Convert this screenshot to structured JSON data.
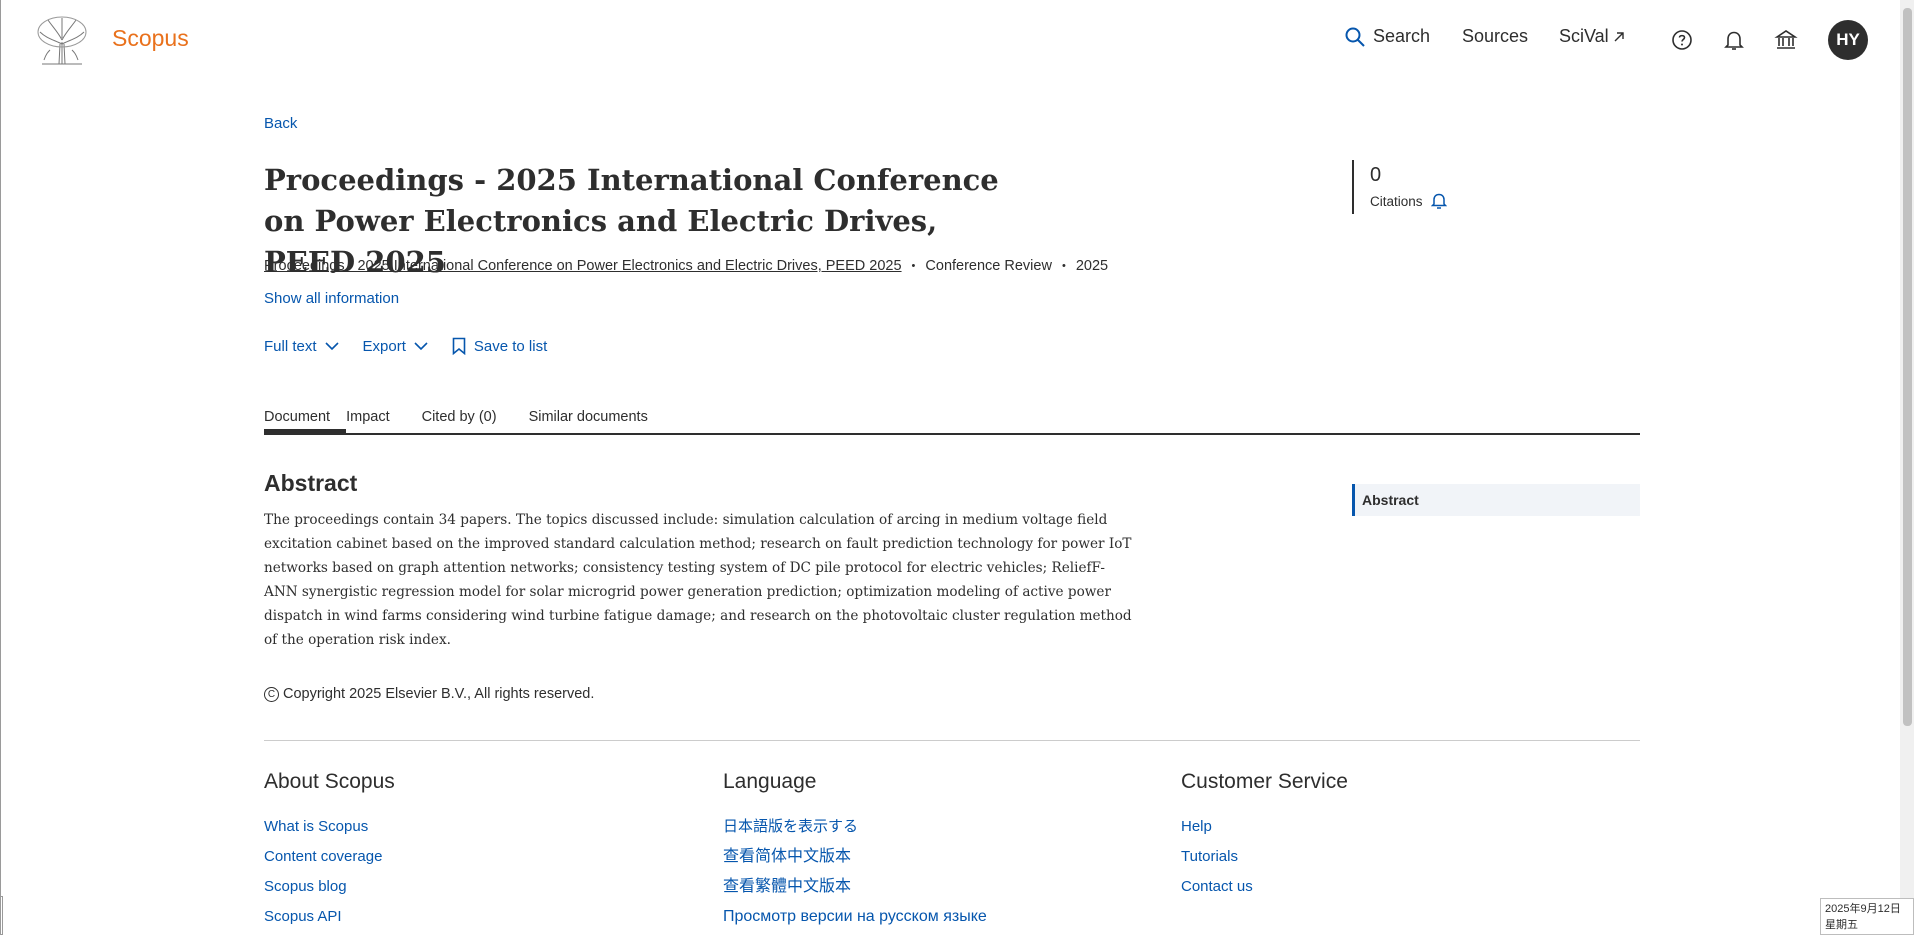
{
  "header": {
    "brand": "Scopus",
    "nav": {
      "search": "Search",
      "sources": "Sources",
      "scival": "SciVal"
    },
    "avatar_initials": "HY",
    "icons": [
      "help-icon",
      "bell-icon",
      "institution-icon"
    ]
  },
  "page": {
    "back": "Back",
    "title": "Proceedings - 2025 International Conference on Power Electronics and Electric Drives, PEED 2025",
    "source_link": "Proceedings - 2025 International Conference on Power Electronics and Electric Drives, PEED 2025",
    "doc_type": "Conference Review",
    "year": "2025",
    "show_all": "Show all information"
  },
  "actions": {
    "full_text": "Full text",
    "export": "Export",
    "save_to_list": "Save to list"
  },
  "citations": {
    "count": "0",
    "label": "Citations"
  },
  "tabs": [
    "Document",
    "Impact",
    "Cited by (0)",
    "Similar documents"
  ],
  "abstract": {
    "heading": "Abstract",
    "text": "The proceedings contain 34 papers. The topics discussed include: simulation calculation of arcing in medium voltage field excitation cabinet based on the improved standard calculation method; research on fault prediction technology for power IoT networks based on graph attention networks; consistency testing system of DC pile protocol for electric vehicles; ReliefF-ANN synergistic regression model for solar microgrid power generation prediction; optimization modeling of active power dispatch in wind farms considering wind turbine fatigue damage; and research on the photovoltaic cluster regulation method of the operation risk index.",
    "side_nav": "Abstract"
  },
  "copyright": "Copyright 2025 Elsevier B.V., All rights reserved.",
  "footer": {
    "about": {
      "heading": "About Scopus",
      "links": [
        "What is Scopus",
        "Content coverage",
        "Scopus blog",
        "Scopus API"
      ]
    },
    "language": {
      "heading": "Language",
      "links": [
        "日本語版を表示する",
        "查看简体中文版本",
        "查看繁體中文版本",
        "Просмотр версии на русском языке"
      ]
    },
    "customer_service": {
      "heading": "Customer Service",
      "links": [
        "Help",
        "Tutorials",
        "Contact us"
      ]
    }
  },
  "taskbar_clock": {
    "date": "2025年9月12日",
    "weekday": "星期五"
  },
  "colors": {
    "brand_orange": "#e9711c",
    "link_blue": "#0656ad",
    "text": "#2e2e2e"
  }
}
